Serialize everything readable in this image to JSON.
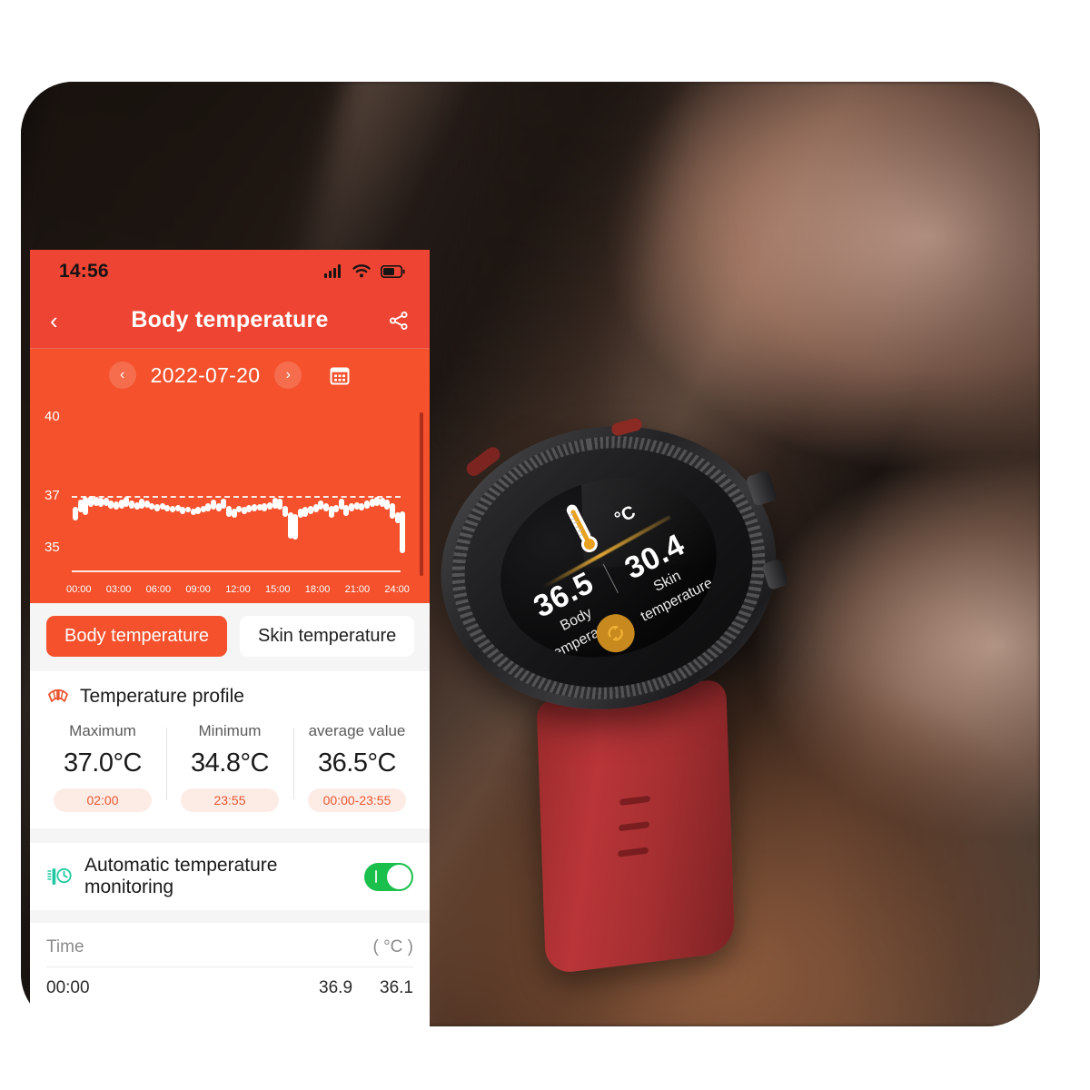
{
  "app": {
    "status_bar": {
      "time": "14:56",
      "icons": [
        "signal-icon",
        "wifi-icon",
        "battery-icon"
      ],
      "battery_level_pct": 60
    },
    "nav": {
      "back_icon": "chevron-left-icon",
      "title": "Body temperature",
      "share_icon": "share-icon"
    },
    "date_selector": {
      "prev_icon": "chevron-left-icon",
      "date": "2022-07-20",
      "next_icon": "chevron-right-icon",
      "calendar_icon": "calendar-icon"
    },
    "tabs": [
      {
        "label": "Body temperature",
        "active": true
      },
      {
        "label": "Skin temperature",
        "active": false
      }
    ],
    "profile": {
      "icon": "thermometer-rays-icon",
      "title": "Temperature profile",
      "stats": [
        {
          "label": "Maximum",
          "value": "37.0°C",
          "chip": "02:00"
        },
        {
          "label": "Minimum",
          "value": "34.8°C",
          "chip": "23:55"
        },
        {
          "label": "average value",
          "value": "36.5°C",
          "chip": "00:00-23:55"
        }
      ]
    },
    "auto_monitoring": {
      "icon": "thermometer-clock-icon",
      "label": "Automatic temperature monitoring",
      "toggle_on": true
    },
    "table": {
      "col_time": "Time",
      "col_unit": "( °C )",
      "rows": [
        {
          "time": "00:00",
          "v1": "36.9",
          "v2": "36.1"
        }
      ]
    },
    "colors": {
      "header_orange": "#EE4433",
      "chart_orange": "#F4512C",
      "tab_active": "#F4512C",
      "chip_bg": "#FDECE6",
      "chip_text": "#E9552F",
      "toggle_green": "#1BBF4C",
      "profile_icon": "#E9552F",
      "auto_icon": "#1EC8A0"
    }
  },
  "watch": {
    "degree_unit": "°C",
    "thermometer_icon": "thermometer-icon",
    "body": {
      "value": "36.5",
      "label_line1": "Body",
      "label_line2": "temperature"
    },
    "skin": {
      "value": "30.4",
      "label_line1": "Skin",
      "label_line2": "temperature"
    },
    "refresh_icon": "refresh-icon",
    "colors": {
      "accent": "#C8891F",
      "strap": "#B93538",
      "beam": "#F0B034"
    }
  },
  "chart_data": {
    "type": "bar",
    "title": "Body temperature",
    "subtitle": "2022-07-20",
    "xlabel": "",
    "ylabel": "",
    "unit": "°C",
    "ylim": [
      34.2,
      40.6
    ],
    "yticks": [
      40,
      37,
      35
    ],
    "ytick_labels": [
      "40",
      "37",
      "35"
    ],
    "xticks": [
      "00:00",
      "03:00",
      "06:00",
      "09:00",
      "12:00",
      "15:00",
      "18:00",
      "21:00",
      "24:00"
    ],
    "grid": false,
    "legend": false,
    "reference_line": {
      "value": 37,
      "style": "dashed",
      "color": "#FFFFFF"
    },
    "note": "floating range bars: each bar spans [low, high] body temperature for a 15-min sample",
    "bars": [
      {
        "low": 36.05,
        "high": 36.55
      },
      {
        "low": 36.35,
        "high": 36.85
      },
      {
        "low": 36.25,
        "high": 36.95
      },
      {
        "low": 36.55,
        "high": 37.0
      },
      {
        "low": 36.6,
        "high": 36.95
      },
      {
        "low": 36.55,
        "high": 36.9
      },
      {
        "low": 36.6,
        "high": 36.92
      },
      {
        "low": 36.5,
        "high": 36.8
      },
      {
        "low": 36.45,
        "high": 36.78
      },
      {
        "low": 36.5,
        "high": 36.85
      },
      {
        "low": 36.55,
        "high": 36.95
      },
      {
        "low": 36.5,
        "high": 36.8
      },
      {
        "low": 36.45,
        "high": 36.75
      },
      {
        "low": 36.5,
        "high": 36.88
      },
      {
        "low": 36.52,
        "high": 36.82
      },
      {
        "low": 36.45,
        "high": 36.72
      },
      {
        "low": 36.4,
        "high": 36.68
      },
      {
        "low": 36.45,
        "high": 36.7
      },
      {
        "low": 36.38,
        "high": 36.62
      },
      {
        "low": 36.35,
        "high": 36.6
      },
      {
        "low": 36.4,
        "high": 36.65
      },
      {
        "low": 36.3,
        "high": 36.55
      },
      {
        "low": 36.35,
        "high": 36.58
      },
      {
        "low": 36.25,
        "high": 36.5
      },
      {
        "low": 36.3,
        "high": 36.55
      },
      {
        "low": 36.35,
        "high": 36.6
      },
      {
        "low": 36.4,
        "high": 36.7
      },
      {
        "low": 36.45,
        "high": 36.85
      },
      {
        "low": 36.4,
        "high": 36.72
      },
      {
        "low": 36.5,
        "high": 36.88
      },
      {
        "low": 36.2,
        "high": 36.6
      },
      {
        "low": 36.15,
        "high": 36.5
      },
      {
        "low": 36.35,
        "high": 36.6
      },
      {
        "low": 36.3,
        "high": 36.55
      },
      {
        "low": 36.35,
        "high": 36.62
      },
      {
        "low": 36.4,
        "high": 36.66
      },
      {
        "low": 36.42,
        "high": 36.68
      },
      {
        "low": 36.4,
        "high": 36.7
      },
      {
        "low": 36.45,
        "high": 36.75
      },
      {
        "low": 36.5,
        "high": 36.9
      },
      {
        "low": 36.45,
        "high": 36.88
      },
      {
        "low": 36.2,
        "high": 36.6
      },
      {
        "low": 35.35,
        "high": 36.35
      },
      {
        "low": 35.3,
        "high": 36.3
      },
      {
        "low": 36.15,
        "high": 36.5
      },
      {
        "low": 36.2,
        "high": 36.55
      },
      {
        "low": 36.3,
        "high": 36.6
      },
      {
        "low": 36.35,
        "high": 36.68
      },
      {
        "low": 36.45,
        "high": 36.82
      },
      {
        "low": 36.4,
        "high": 36.72
      },
      {
        "low": 36.15,
        "high": 36.6
      },
      {
        "low": 36.35,
        "high": 36.62
      },
      {
        "low": 36.45,
        "high": 36.88
      },
      {
        "low": 36.2,
        "high": 36.62
      },
      {
        "low": 36.4,
        "high": 36.7
      },
      {
        "low": 36.45,
        "high": 36.75
      },
      {
        "low": 36.42,
        "high": 36.72
      },
      {
        "low": 36.5,
        "high": 36.8
      },
      {
        "low": 36.55,
        "high": 36.88
      },
      {
        "low": 36.6,
        "high": 36.95
      },
      {
        "low": 36.55,
        "high": 36.92
      },
      {
        "low": 36.45,
        "high": 36.85
      },
      {
        "low": 36.1,
        "high": 36.7
      },
      {
        "low": 35.95,
        "high": 36.35
      },
      {
        "low": 34.8,
        "high": 36.4
      }
    ]
  }
}
